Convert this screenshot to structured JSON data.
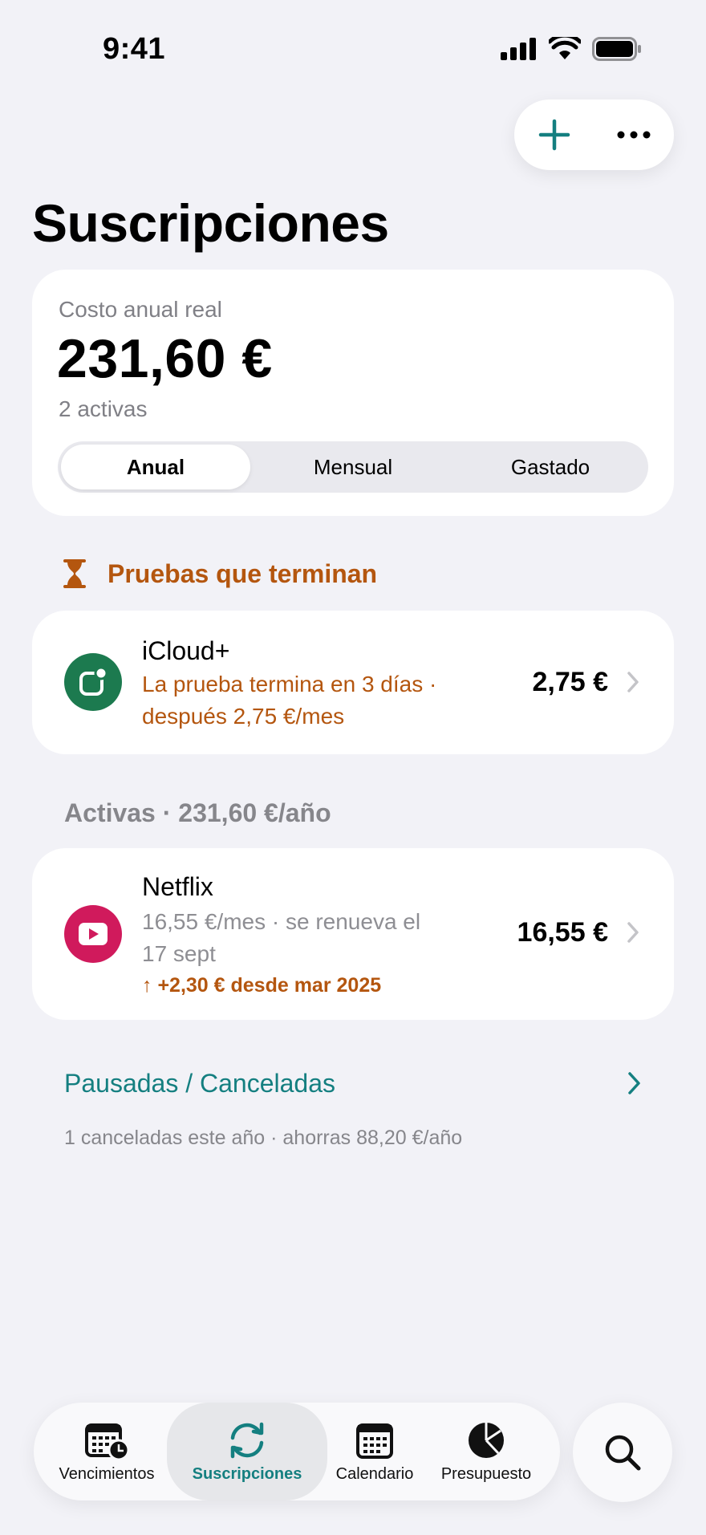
{
  "status_bar": {
    "time": "9:41"
  },
  "page": {
    "title": "Suscripciones"
  },
  "summary": {
    "label": "Costo anual real",
    "amount": "231,60 €",
    "count": "2 activas",
    "segments": [
      "Anual",
      "Mensual",
      "Gastado"
    ],
    "selected_segment": "Anual"
  },
  "trials": {
    "header": "Pruebas que terminan",
    "items": [
      {
        "name": "iCloud+",
        "subtitle_line1": "La prueba termina en 3 días ·",
        "subtitle_line2": "después 2,75 €/mes",
        "price": "2,75 €",
        "icon": "cloud-icon",
        "icon_color": "#1c7a4f"
      }
    ]
  },
  "active": {
    "header": "Activas · 231,60 €/año",
    "items": [
      {
        "name": "Netflix",
        "subtitle_line1": "16,55 €/mes · se renueva el",
        "subtitle_line2": "17 sept",
        "change": "↑ +2,30 € desde mar 2025",
        "price": "16,55 €",
        "icon": "play-icon",
        "icon_color": "#d01a5c"
      }
    ]
  },
  "paused": {
    "label": "Pausadas / Canceladas",
    "note": "1 canceladas este año · ahorras 88,20 €/año"
  },
  "tabbar": {
    "tabs": [
      {
        "label": "Vencimientos",
        "icon": "calendar-clock-icon"
      },
      {
        "label": "Suscripciones",
        "icon": "refresh-icon"
      },
      {
        "label": "Calendario",
        "icon": "calendar-icon"
      },
      {
        "label": "Presupuesto",
        "icon": "pie-chart-icon"
      }
    ],
    "selected": "Suscripciones"
  },
  "colors": {
    "accent": "#147f80",
    "warning": "#b4560f",
    "background": "#f2f2f7"
  }
}
